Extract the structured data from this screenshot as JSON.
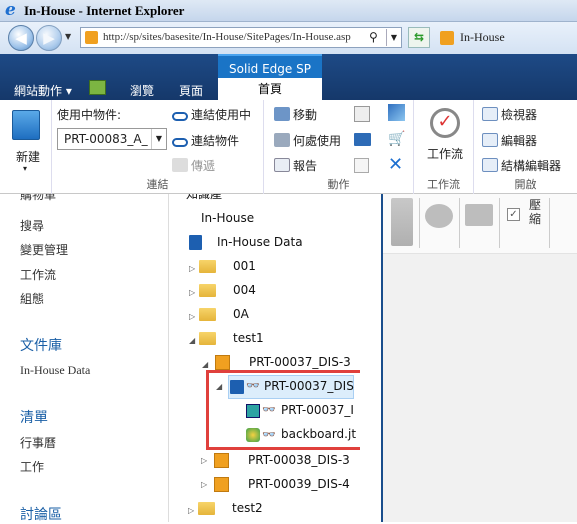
{
  "window": {
    "title": "In-House - Internet Explorer",
    "url": "http://sp/sites/basesite/In-House/SitePages/In-House.asp",
    "tab_label": "In-House"
  },
  "menubar": {
    "site_actions": "網站動作",
    "browse": "瀏覽",
    "page": "頁面",
    "context_group": "Solid Edge SP",
    "active_tab": "首頁"
  },
  "ribbon": {
    "new_label": "新建",
    "used_in_label": "使用中物件:",
    "used_in_value": "PRT-00083_A_",
    "link_used": "連結使用中",
    "link_object": "連結物件",
    "pass_back": "傳遞",
    "link_group": "連結",
    "move": "移動",
    "where_used": "何處使用",
    "report": "報告",
    "action_group": "動作",
    "workflow_label": "工作流",
    "workflow_group": "工作流",
    "viewer": "檢視器",
    "editor": "編輯器",
    "structure_editor": "結構編輯器",
    "open_group": "開啟"
  },
  "leftnav": {
    "items": [
      "購物車",
      "搜尋",
      "變更管理",
      "工作流",
      "組態"
    ],
    "doclib_header": "文件庫",
    "doclib_item": "In-House Data",
    "lists_header": "清單",
    "lists_items": [
      "行事曆",
      "工作"
    ],
    "discussion_header": "討論區"
  },
  "tree": {
    "partial_top": "知識產",
    "root": "In-House",
    "library": "In-House Data",
    "folders": [
      "001",
      "004",
      "0A",
      "test1"
    ],
    "doc1": "PRT-00037_DIS-3",
    "selected": "PRT-00037_DIS",
    "child1": "PRT-00037_I",
    "child2": "backboard.jt",
    "doc2": "PRT-00038_DIS-3",
    "doc3": "PRT-00039_DIS-4",
    "folder_last": "test2"
  },
  "viewer": {
    "compress_label": "壓縮"
  }
}
